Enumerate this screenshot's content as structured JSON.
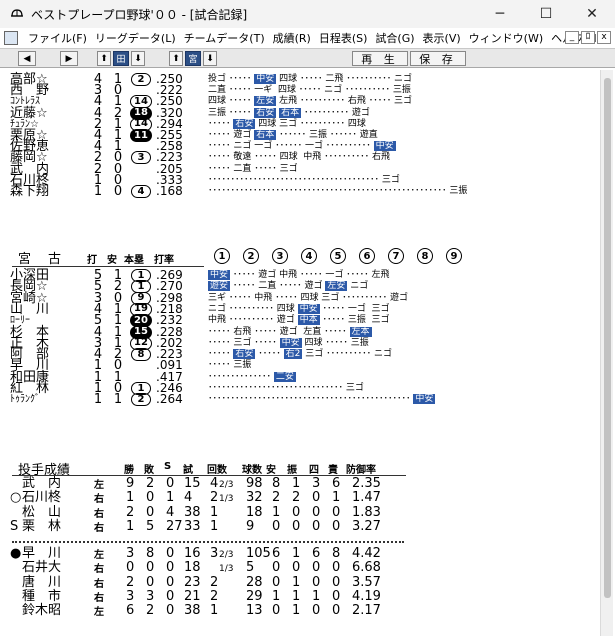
{
  "window": {
    "title": "ベストプレープロ野球'００ - [試合記録]",
    "controls": [
      "─",
      "☐",
      "✕"
    ]
  },
  "menu": [
    "ファイル(F)",
    "リーグデータ(L)",
    "チームデータ(T)",
    "成績(R)",
    "日程表(S)",
    "試合(G)",
    "表示(V)",
    "ウィンドウ(W)",
    "ヘルプ(H)"
  ],
  "mdi_controls": [
    "_",
    "ﾛ",
    "x"
  ],
  "toolbar": {
    "left_arrow": "◀",
    "right_arrow": "▶",
    "up1": "⬆",
    "team_home": "田",
    "down1": "⬇",
    "up2": "⬆",
    "team_away": "宮",
    "down2": "⬇",
    "replay": "再 生",
    "save": "保 存"
  },
  "team1": {
    "batters": [
      {
        "name": "高部☆",
        "ab": "4",
        "h": "1",
        "rbi": "2",
        "rbi_style": "circle",
        "avg": ".250",
        "pa": [
          [
            "投ゴ ･････ "
          ],
          [
            "中安",
            1
          ],
          [
            " 四球 ･････ 二飛 ･･････････ ニゴ"
          ]
        ]
      },
      {
        "name": "西　野",
        "ab": "3",
        "h": "0",
        "rbi": "",
        "rbi_style": "",
        "avg": ".222",
        "pa": [
          [
            "二直 ･････ 一ギ  四球 ･････ ニゴ ･･････････ 三振"
          ]
        ]
      },
      {
        "name": "ｺﾝﾄﾚﾗｽ",
        "ab": "4",
        "h": "1",
        "rbi": "14",
        "rbi_style": "circle",
        "avg": ".250",
        "pa": [
          [
            "四球 ･････ "
          ],
          [
            "左安",
            1
          ],
          [
            " 左飛 ･･････････ 右飛 ･････ 三ゴ"
          ]
        ]
      },
      {
        "name": "近藤☆",
        "ab": "4",
        "h": "2",
        "rbi": "18",
        "rbi_style": "fill",
        "avg": ".320",
        "pa": [
          [
            "三振 ･････ "
          ],
          [
            "右安",
            1
          ],
          [
            " "
          ],
          [
            "右本",
            1
          ],
          [
            " ･･････････ 遊ゴ"
          ]
        ]
      },
      {
        "name": "ﾁｭﾗﾝ☆",
        "ab": "2",
        "h": "1",
        "rbi": "14",
        "rbi_style": "circle",
        "avg": ".294",
        "pa": [
          [
            "･････ "
          ],
          [
            "右安",
            1
          ],
          [
            " 四球 三ゴ ･･････････ 四球"
          ]
        ]
      },
      {
        "name": "栗原☆",
        "ab": "4",
        "h": "1",
        "rbi": "11",
        "rbi_style": "fill",
        "avg": ".255",
        "pa": [
          [
            "･････ 遊ゴ "
          ],
          [
            "右本",
            1
          ],
          [
            " ･･････ 三振 ･･････ 遊直"
          ]
        ]
      },
      {
        "name": "佐野恵",
        "ab": "4",
        "h": "1",
        "rbi": "",
        "rbi_style": "",
        "avg": ".258",
        "pa": [
          [
            "･････ ニゴ 一ゴ ･･････ 一ゴ ･･････････ "
          ],
          [
            "中安",
            1
          ]
        ]
      },
      {
        "name": "藤岡☆",
        "ab": "2",
        "h": "0",
        "rbi": "3",
        "rbi_style": "circle",
        "avg": ".223",
        "pa": [
          [
            "･････ 敬遠 ･････ 四球  中飛 ･･････････ 右飛"
          ]
        ]
      },
      {
        "name": "武　内",
        "ab": "2",
        "h": "0",
        "rbi": "",
        "rbi_style": "",
        "avg": ".205",
        "pa": [
          [
            "･････ 二直 ･････ 三ゴ"
          ]
        ]
      },
      {
        "name": "石川柊",
        "ab": "1",
        "h": "0",
        "rbi": "",
        "rbi_style": "",
        "avg": ".333",
        "pa": [
          [
            "･･････････････････････････････････････ 三ゴ"
          ]
        ]
      },
      {
        "name": "森下翔",
        "ab": "1",
        "h": "0",
        "rbi": "4",
        "rbi_style": "circle",
        "avg": ".168",
        "pa": [
          [
            "･････････････････････････････････････････････････････ 三振"
          ]
        ]
      }
    ]
  },
  "team2": {
    "name": "宮　古",
    "headers": {
      "ab": "打",
      "h": "安",
      "hr": "本塁",
      "avg": "打率"
    },
    "innings": [
      "1",
      "2",
      "3",
      "4",
      "5",
      "6",
      "7",
      "8",
      "9"
    ],
    "batters": [
      {
        "name": "小深田",
        "ab": "5",
        "h": "1",
        "rbi": "1",
        "rbi_style": "circle",
        "avg": ".269",
        "pa": [
          [
            "中安",
            1
          ],
          [
            " ･････ 遊ゴ 中飛 ･････ 一ゴ ･････ 左飛"
          ]
        ]
      },
      {
        "name": "長岡☆",
        "ab": "5",
        "h": "2",
        "rbi": "1",
        "rbi_style": "circle",
        "avg": ".270",
        "pa": [
          [
            "遊安",
            1
          ],
          [
            " ･････ 二直 ･････ 遊ゴ "
          ],
          [
            "左安",
            1
          ],
          [
            " ニゴ"
          ]
        ]
      },
      {
        "name": "宮崎☆",
        "ab": "3",
        "h": "0",
        "rbi": "9",
        "rbi_style": "circle",
        "avg": ".298",
        "pa": [
          [
            "三ギ ･････ 中飛 ･････ 四球 三ゴ ･･････････ 遊ゴ"
          ]
        ]
      },
      {
        "name": "山　川",
        "ab": "4",
        "h": "1",
        "rbi": "19",
        "rbi_style": "circle",
        "avg": ".218",
        "pa": [
          [
            "ニゴ ･･････････ 四球 "
          ],
          [
            "中安",
            1
          ],
          [
            " ･････ 一ゴ  三ゴ"
          ]
        ]
      },
      {
        "name": "ﾛｰﾘｰ",
        "ab": "5",
        "h": "1",
        "rbi": "20",
        "rbi_style": "fill",
        "avg": ".232",
        "pa": [
          [
            "中飛 ･･････････ 遊ゴ "
          ],
          [
            "中本",
            1
          ],
          [
            " ･････ 三振  三ゴ"
          ]
        ]
      },
      {
        "name": "杉　本",
        "ab": "4",
        "h": "1",
        "rbi": "15",
        "rbi_style": "fill",
        "avg": ".228",
        "pa": [
          [
            "･････ 右飛 ･････ 遊ゴ  左直 ･････ "
          ],
          [
            "左本",
            1
          ]
        ]
      },
      {
        "name": "正　木",
        "ab": "3",
        "h": "1",
        "rbi": "12",
        "rbi_style": "circle",
        "avg": ".202",
        "pa": [
          [
            "･････ 三ゴ ･････ "
          ],
          [
            "中安",
            1
          ],
          [
            " 四球 ･････ 三振"
          ]
        ]
      },
      {
        "name": "阿　部",
        "ab": "4",
        "h": "2",
        "rbi": "8",
        "rbi_style": "circle",
        "avg": ".223",
        "pa": [
          [
            "･････ "
          ],
          [
            "右安",
            1
          ],
          [
            " ･････ "
          ],
          [
            "右2",
            1
          ],
          [
            " 三ゴ ･･････････ ニゴ"
          ]
        ]
      },
      {
        "name": "早　川",
        "ab": "1",
        "h": "0",
        "rbi": "",
        "rbi_style": "",
        "avg": ".091",
        "pa": [
          [
            "･････ 三振"
          ]
        ]
      },
      {
        "name": "和田康",
        "ab": "1",
        "h": "1",
        "rbi": "",
        "rbi_style": "",
        "avg": ".417",
        "pa": [
          [
            "･･････････････ "
          ],
          [
            "二安",
            1
          ]
        ]
      },
      {
        "name": "紅　林",
        "ab": "1",
        "h": "0",
        "rbi": "1",
        "rbi_style": "circle",
        "avg": ".246",
        "pa": [
          [
            "･･････････････････････････････ 三ゴ"
          ]
        ]
      },
      {
        "name": "ﾄｩﾗﾝｸﾞ",
        "ab": "1",
        "h": "1",
        "rbi": "2",
        "rbi_style": "circle",
        "avg": ".264",
        "pa": [
          [
            "･････････････････････････････････････････････ "
          ],
          [
            "中安",
            1
          ]
        ]
      }
    ]
  },
  "pitching": {
    "title": "投手成績",
    "headers": [
      "勝",
      "敗",
      "S",
      "試",
      "回数",
      "球数",
      "安",
      "振",
      "四",
      "責",
      "防御率"
    ],
    "team1": [
      {
        "mark": "",
        "name": "武　内",
        "hand": "左",
        "w": "9",
        "l": "2",
        "s": "0",
        "g": "15",
        "ip": "4",
        "ipf": "2/3",
        "np": "98",
        "h": "8",
        "k": "1",
        "bb": "3",
        "er": "6",
        "era": "2.35"
      },
      {
        "mark": "○",
        "name": "石川柊",
        "hand": "右",
        "w": "1",
        "l": "0",
        "s": "1",
        "g": "4",
        "ip": "2",
        "ipf": "1/3",
        "np": "32",
        "h": "2",
        "k": "2",
        "bb": "0",
        "er": "1",
        "era": "1.47"
      },
      {
        "mark": "",
        "name": "松　山",
        "hand": "右",
        "w": "2",
        "l": "0",
        "s": "4",
        "g": "38",
        "ip": "1",
        "ipf": "",
        "np": "18",
        "h": "1",
        "k": "0",
        "bb": "0",
        "er": "0",
        "era": "1.83"
      },
      {
        "mark": "S",
        "name": "栗　林",
        "hand": "右",
        "w": "1",
        "l": "5",
        "s": "27",
        "g": "33",
        "ip": "1",
        "ipf": "",
        "np": "9",
        "h": "0",
        "k": "0",
        "bb": "0",
        "er": "0",
        "era": "3.27"
      }
    ],
    "team2": [
      {
        "mark": "●",
        "name": "早　川",
        "hand": "左",
        "w": "3",
        "l": "8",
        "s": "0",
        "g": "16",
        "ip": "3",
        "ipf": "2/3",
        "np": "105",
        "h": "6",
        "k": "1",
        "bb": "6",
        "er": "8",
        "era": "4.42"
      },
      {
        "mark": "",
        "name": "石井大",
        "hand": "右",
        "w": "0",
        "l": "0",
        "s": "0",
        "g": "18",
        "ip": "",
        "ipf": "1/3",
        "np": "5",
        "h": "0",
        "k": "0",
        "bb": "0",
        "er": "0",
        "era": "6.68"
      },
      {
        "mark": "",
        "name": "唐　川",
        "hand": "右",
        "w": "2",
        "l": "0",
        "s": "0",
        "g": "23",
        "ip": "2",
        "ipf": "",
        "np": "28",
        "h": "0",
        "k": "1",
        "bb": "0",
        "er": "0",
        "era": "3.57"
      },
      {
        "mark": "",
        "name": "種　市",
        "hand": "右",
        "w": "3",
        "l": "3",
        "s": "0",
        "g": "21",
        "ip": "2",
        "ipf": "",
        "np": "29",
        "h": "1",
        "k": "1",
        "bb": "1",
        "er": "0",
        "era": "4.19"
      },
      {
        "mark": "",
        "name": "鈴木昭",
        "hand": "左",
        "w": "6",
        "l": "2",
        "s": "0",
        "g": "38",
        "ip": "1",
        "ipf": "",
        "np": "13",
        "h": "0",
        "k": "1",
        "bb": "0",
        "er": "0",
        "era": "2.17"
      }
    ]
  }
}
